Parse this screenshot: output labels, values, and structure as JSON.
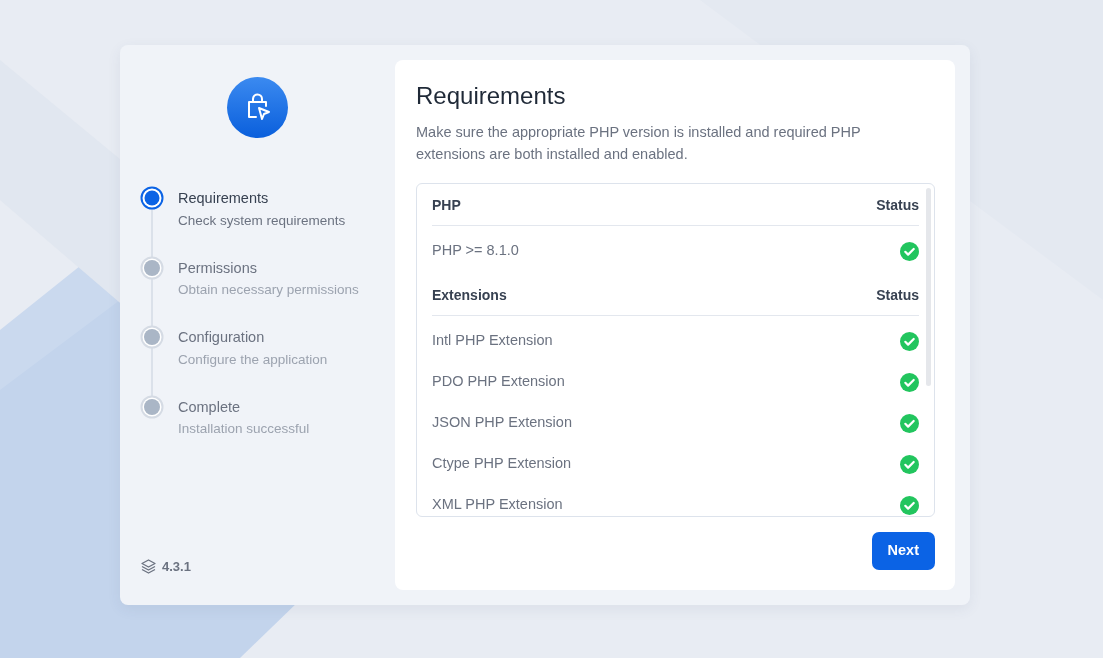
{
  "steps": [
    {
      "title": "Requirements",
      "subtitle": "Check system requirements",
      "selected": true
    },
    {
      "title": "Permissions",
      "subtitle": "Obtain necessary permissions",
      "selected": false
    },
    {
      "title": "Configuration",
      "subtitle": "Configure the application",
      "selected": false
    },
    {
      "title": "Complete",
      "subtitle": "Installation successful",
      "selected": false
    }
  ],
  "version": "4.3.1",
  "heading": "Requirements",
  "description": "Make sure the appropriate PHP version is installed and required PHP extensions are both installed and enabled.",
  "sections": [
    {
      "title": "PHP",
      "status_heading": "Status",
      "rows": [
        {
          "name": "PHP >= 8.1.0",
          "ok": true
        }
      ]
    },
    {
      "title": "Extensions",
      "status_heading": "Status",
      "rows": [
        {
          "name": "Intl PHP Extension",
          "ok": true
        },
        {
          "name": "PDO PHP Extension",
          "ok": true
        },
        {
          "name": "JSON PHP Extension",
          "ok": true
        },
        {
          "name": "Ctype PHP Extension",
          "ok": true
        },
        {
          "name": "XML PHP Extension",
          "ok": true
        }
      ]
    }
  ],
  "next_button": "Next"
}
